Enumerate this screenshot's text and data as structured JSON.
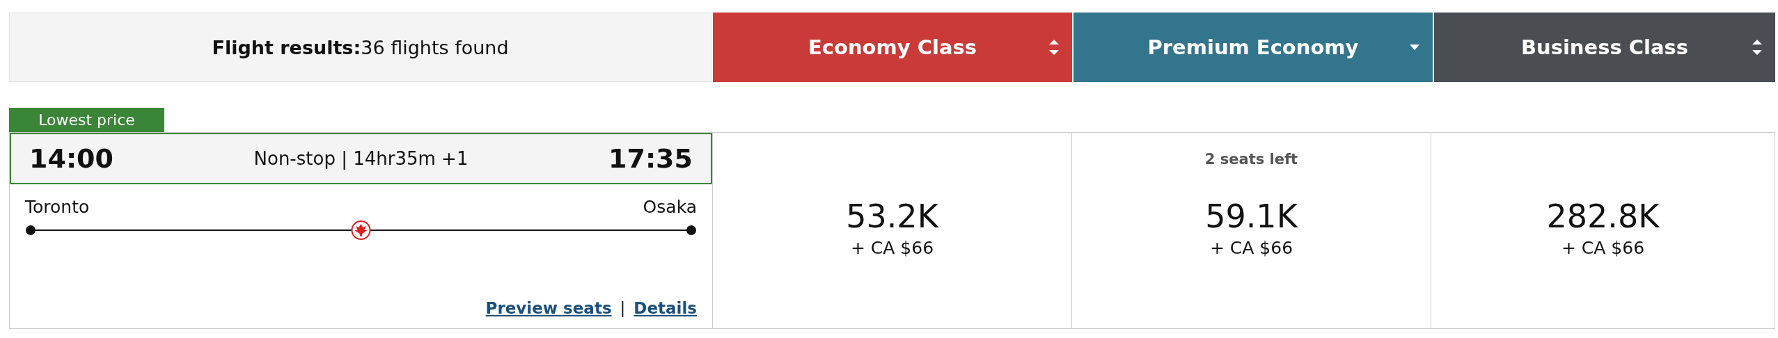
{
  "results_header": {
    "label": "Flight results:",
    "count": "36 flights found"
  },
  "cabins": [
    {
      "name": "Economy Class",
      "color": "#c93a38",
      "kind": "sort"
    },
    {
      "name": "Premium Economy",
      "color": "#33758c",
      "kind": "dropdown"
    },
    {
      "name": "Business Class",
      "color": "#4a4d52",
      "kind": "sort"
    }
  ],
  "flight": {
    "badge": "Lowest price",
    "depart_time": "14:00",
    "summary": "Non-stop | 14hr35m +1",
    "arrive_time": "17:35",
    "origin": "Toronto",
    "destination": "Osaka",
    "links": [
      "Preview seats",
      "|",
      "Details"
    ],
    "fares": [
      {
        "points": "53.2K",
        "cash": "+ CA $66"
      },
      {
        "note": "2 seats left",
        "points": "59.1K",
        "cash": "+ CA $66"
      },
      {
        "points": "282.8K",
        "cash": "+ CA $66"
      }
    ]
  }
}
